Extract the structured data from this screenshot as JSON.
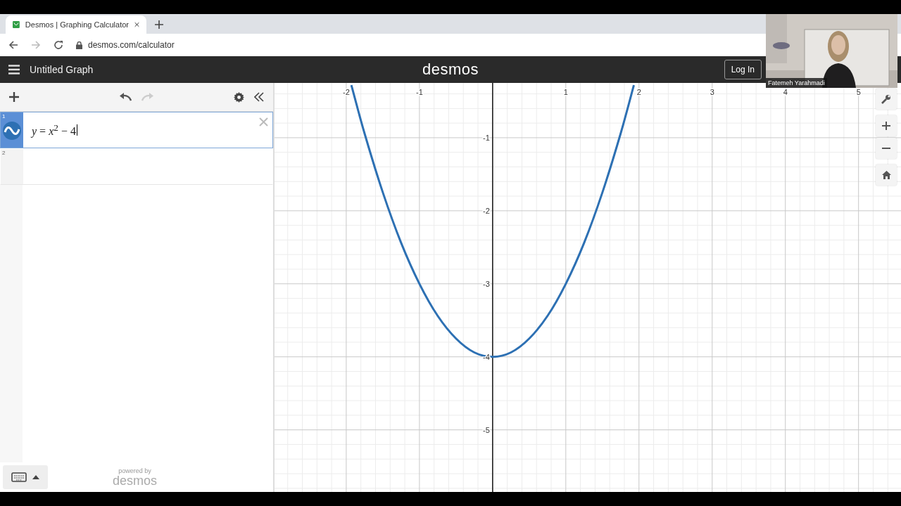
{
  "browser": {
    "tabs": [
      {
        "title": "Desmos | Graphing Calculator",
        "selected": true
      }
    ],
    "url": "desmos.com/calculator"
  },
  "header": {
    "title": "Untitled Graph",
    "logo": "desmos",
    "login": "Log In"
  },
  "toolbar": {
    "undo_disabled": false,
    "redo_disabled": true
  },
  "expressions": [
    {
      "index": "1",
      "text": "*y* = *x*$^{2}$ − 4",
      "selected": true
    },
    {
      "index": "2",
      "selected": false
    }
  ],
  "footer": {
    "powered": "powered by",
    "brand": "desmos"
  },
  "graph": {
    "chart_data": {
      "type": "line",
      "grid": true,
      "xlim": [
        -2.98,
        5.58
      ],
      "ylim": [
        -5.85,
        -0.25
      ],
      "xticks": [
        -2,
        -1,
        1,
        2,
        3,
        4,
        5
      ],
      "yticks": [
        -1,
        -2,
        -3,
        -4,
        -5
      ],
      "x": [
        -1.93,
        -1.75,
        -1.5,
        -1.25,
        -1,
        -0.75,
        -0.5,
        -0.25,
        0,
        0.25,
        0.5,
        0.75,
        1,
        1.25,
        1.5,
        1.75,
        1.93
      ],
      "series": [
        {
          "color": "#2d70b3",
          "values": [
            -0.28,
            -0.94,
            -1.75,
            -2.44,
            -3,
            -3.44,
            -3.75,
            -3.94,
            -4,
            -3.94,
            -3.75,
            -3.44,
            -3,
            -2.44,
            -1.75,
            -0.94,
            -0.28
          ]
        }
      ]
    }
  },
  "webcam": {
    "name": "Fatemeh Yarahmadi"
  }
}
